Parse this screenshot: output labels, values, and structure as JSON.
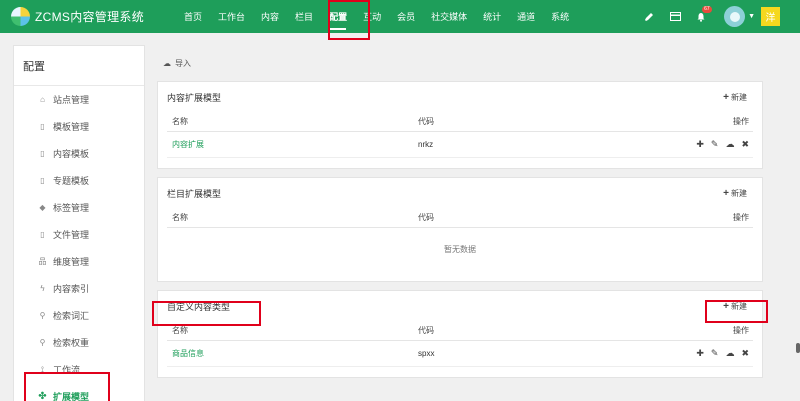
{
  "app": {
    "title": "ZCMS内容管理系统"
  },
  "nav": [
    {
      "label": "首页"
    },
    {
      "label": "工作台"
    },
    {
      "label": "内容"
    },
    {
      "label": "栏目"
    },
    {
      "label": "配置",
      "active": true
    },
    {
      "label": "互动"
    },
    {
      "label": "会员"
    },
    {
      "label": "社交媒体"
    },
    {
      "label": "统计"
    },
    {
      "label": "通道"
    },
    {
      "label": "系统"
    }
  ],
  "toolbar": {
    "notification_count": "67",
    "user_initial": "洋"
  },
  "sidebar": {
    "title": "配置",
    "items": [
      {
        "label": "站点管理",
        "icon": "home-icon"
      },
      {
        "label": "模板管理",
        "icon": "file-icon"
      },
      {
        "label": "内容模板",
        "icon": "file-icon"
      },
      {
        "label": "专题模板",
        "icon": "file-icon"
      },
      {
        "label": "标签管理",
        "icon": "tags-icon"
      },
      {
        "label": "文件管理",
        "icon": "file-icon"
      },
      {
        "label": "维度管理",
        "icon": "sitemap-icon"
      },
      {
        "label": "内容索引",
        "icon": "bolt-icon"
      },
      {
        "label": "检索词汇",
        "icon": "search-icon"
      },
      {
        "label": "检索权重",
        "icon": "search-icon"
      },
      {
        "label": "工作流",
        "icon": "flow-icon"
      },
      {
        "label": "扩展模型",
        "icon": "cubes-icon",
        "active": true
      }
    ]
  },
  "main": {
    "import_label": "导入",
    "table_headers": {
      "name": "名称",
      "code": "代码",
      "ops": "操作"
    },
    "new_label": "新建",
    "panels": [
      {
        "title": "内容扩展模型",
        "rows": [
          {
            "name": "内容扩展",
            "code": "nrkz"
          }
        ]
      },
      {
        "title": "栏目扩展模型",
        "rows": [],
        "empty_text": "暂无数据"
      },
      {
        "title": "自定义内容类型",
        "rows": [
          {
            "name": "商品信息",
            "code": "spxx"
          }
        ]
      }
    ]
  }
}
